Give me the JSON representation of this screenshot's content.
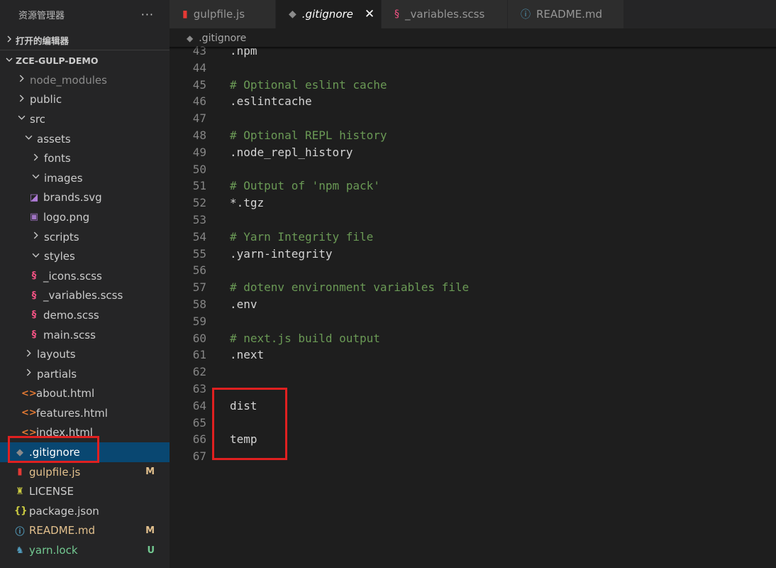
{
  "explorer": {
    "title": "资源管理器",
    "more": "···",
    "open_editors": "打开的编辑器",
    "project": "ZCE-GULP-DEMO"
  },
  "tree": [
    {
      "label": "node_modules",
      "indent": 0,
      "type": "folder",
      "open": false,
      "dim": true
    },
    {
      "label": "public",
      "indent": 0,
      "type": "folder",
      "open": false
    },
    {
      "label": "src",
      "indent": 0,
      "type": "folder",
      "open": true
    },
    {
      "label": "assets",
      "indent": 1,
      "type": "folder",
      "open": true
    },
    {
      "label": "fonts",
      "indent": 2,
      "type": "folder",
      "open": false
    },
    {
      "label": "images",
      "indent": 2,
      "type": "folder",
      "open": true
    },
    {
      "label": "brands.svg",
      "indent": 2,
      "type": "file",
      "icon": "svg"
    },
    {
      "label": "logo.png",
      "indent": 2,
      "type": "file",
      "icon": "image"
    },
    {
      "label": "scripts",
      "indent": 2,
      "type": "folder",
      "open": false
    },
    {
      "label": "styles",
      "indent": 2,
      "type": "folder",
      "open": true
    },
    {
      "label": "_icons.scss",
      "indent": 2,
      "type": "file",
      "icon": "scss"
    },
    {
      "label": "_variables.scss",
      "indent": 2,
      "type": "file",
      "icon": "scss"
    },
    {
      "label": "demo.scss",
      "indent": 2,
      "type": "file",
      "icon": "scss"
    },
    {
      "label": "main.scss",
      "indent": 2,
      "type": "file",
      "icon": "scss"
    },
    {
      "label": "layouts",
      "indent": 1,
      "type": "folder",
      "open": false
    },
    {
      "label": "partials",
      "indent": 1,
      "type": "folder",
      "open": false
    },
    {
      "label": "about.html",
      "indent": 1,
      "type": "file",
      "icon": "html"
    },
    {
      "label": "features.html",
      "indent": 1,
      "type": "file",
      "icon": "html"
    },
    {
      "label": "index.html",
      "indent": 1,
      "type": "file",
      "icon": "html"
    },
    {
      "label": ".gitignore",
      "indent": 0,
      "type": "file",
      "icon": "git",
      "selected": true
    },
    {
      "label": "gulpfile.js",
      "indent": 0,
      "type": "file",
      "icon": "gulp",
      "badge": "M",
      "status": "mod"
    },
    {
      "label": "LICENSE",
      "indent": 0,
      "type": "file",
      "icon": "license"
    },
    {
      "label": "package.json",
      "indent": 0,
      "type": "file",
      "icon": "json"
    },
    {
      "label": "README.md",
      "indent": 0,
      "type": "file",
      "icon": "info",
      "badge": "M",
      "status": "mod"
    },
    {
      "label": "yarn.lock",
      "indent": 0,
      "type": "file",
      "icon": "yarn",
      "badge": "U",
      "status": "untracked"
    }
  ],
  "tabs": [
    {
      "label": "gulpfile.js",
      "icon": "gulp",
      "width": 150
    },
    {
      "label": ".gitignore",
      "icon": "git",
      "active": true,
      "close": "✕",
      "width": 149
    },
    {
      "label": "_variables.scss",
      "icon": "scss",
      "width": 178
    },
    {
      "label": "README.md",
      "icon": "info",
      "width": 164
    }
  ],
  "breadcrumb": ".gitignore",
  "editor": {
    "lines": [
      {
        "n": "43",
        "text": ".npm",
        "kind": "plain"
      },
      {
        "n": "44",
        "text": "",
        "kind": "plain"
      },
      {
        "n": "45",
        "text": "# Optional eslint cache",
        "kind": "comment"
      },
      {
        "n": "46",
        "text": ".eslintcache",
        "kind": "plain"
      },
      {
        "n": "47",
        "text": "",
        "kind": "plain"
      },
      {
        "n": "48",
        "text": "# Optional REPL history",
        "kind": "comment"
      },
      {
        "n": "49",
        "text": ".node_repl_history",
        "kind": "plain"
      },
      {
        "n": "50",
        "text": "",
        "kind": "plain"
      },
      {
        "n": "51",
        "text": "# Output of 'npm pack'",
        "kind": "comment"
      },
      {
        "n": "52",
        "text": "*.tgz",
        "kind": "plain"
      },
      {
        "n": "53",
        "text": "",
        "kind": "plain"
      },
      {
        "n": "54",
        "text": "# Yarn Integrity file",
        "kind": "comment"
      },
      {
        "n": "55",
        "text": ".yarn-integrity",
        "kind": "plain"
      },
      {
        "n": "56",
        "text": "",
        "kind": "plain"
      },
      {
        "n": "57",
        "text": "# dotenv environment variables file",
        "kind": "comment"
      },
      {
        "n": "58",
        "text": ".env",
        "kind": "plain"
      },
      {
        "n": "59",
        "text": "",
        "kind": "plain"
      },
      {
        "n": "60",
        "text": "# next.js build output",
        "kind": "comment"
      },
      {
        "n": "61",
        "text": ".next",
        "kind": "plain"
      },
      {
        "n": "62",
        "text": "",
        "kind": "plain"
      },
      {
        "n": "63",
        "text": "",
        "kind": "plain"
      },
      {
        "n": "64",
        "text": "dist",
        "kind": "plain"
      },
      {
        "n": "65",
        "text": "",
        "kind": "plain"
      },
      {
        "n": "66",
        "text": "temp",
        "kind": "plain"
      },
      {
        "n": "67",
        "text": "",
        "kind": "plain"
      }
    ]
  },
  "icons": {
    "folder_closed": "chevron-right-icon",
    "folder_open": "chevron-down-icon"
  },
  "colors": {
    "selection": "#094771",
    "modified": "#e2c08d",
    "untracked": "#73c991",
    "comment": "#6a9955",
    "highlight_box": "#e02020"
  }
}
